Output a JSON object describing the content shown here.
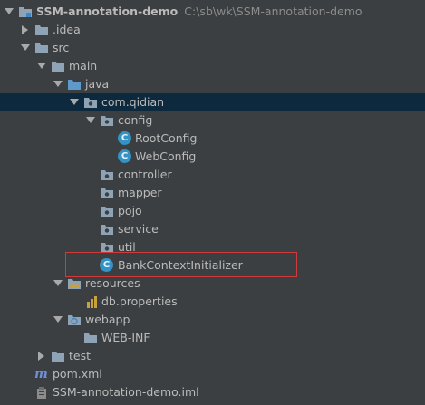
{
  "project": {
    "name": "SSM-annotation-demo",
    "path": "C:\\sb\\wk\\SSM-annotation-demo"
  },
  "tree": {
    "idea": ".idea",
    "src": "src",
    "main": "main",
    "java": "java",
    "package": "com.qidian",
    "config": "config",
    "root_config": "RootConfig",
    "web_config": "WebConfig",
    "controller": "controller",
    "mapper": "mapper",
    "pojo": "pojo",
    "service": "service",
    "util": "util",
    "bank_context_initializer": "BankContextInitializer",
    "resources": "resources",
    "db_properties": "db.properties",
    "webapp": "webapp",
    "web_inf": "WEB-INF",
    "test": "test",
    "pom": "pom.xml",
    "iml": "SSM-annotation-demo.iml"
  },
  "icons": {
    "class_badge": "C",
    "maven_badge": "m"
  },
  "colors": {
    "background": "#3c3f41",
    "selected_row": "#0d293e",
    "folder": "#8ea3b5",
    "source_folder": "#5d9acb",
    "class_icon": "#3592c4",
    "highlight_border": "#d13a3a"
  }
}
